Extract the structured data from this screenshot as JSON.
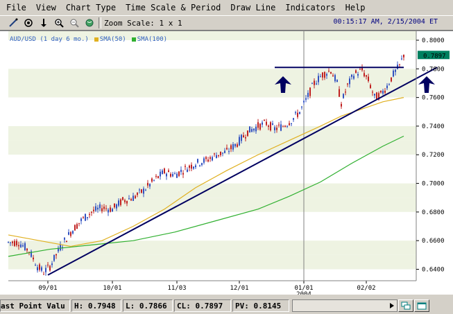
{
  "menu": {
    "items": [
      "File",
      "View",
      "Chart Type",
      "Time Scale & Period",
      "Draw Line",
      "Indicators",
      "Help"
    ]
  },
  "toolbar": {
    "icons": [
      "draw-line-icon",
      "crosshair-icon",
      "arrow-down-icon",
      "zoom-in-icon",
      "zoom-out-icon",
      "globe-icon"
    ],
    "zoom_label": "Zoom Scale: 1 x 1"
  },
  "datetime": "00:15:17 AM, 2/15/2004 ET",
  "legend": {
    "symbol": "AUD/USD (1 day  6 mo.)",
    "sma50": "SMA(50)",
    "sma100": "SMA(100)",
    "sma50_color": "#e0b020",
    "sma100_color": "#30b030"
  },
  "chart_data": {
    "type": "candlestick",
    "ylim": [
      0.632,
      0.8063
    ],
    "yticks": [
      "0.8000",
      "0.7800",
      "0.7600",
      "0.7400",
      "0.7200",
      "0.7000",
      "0.6800",
      "0.6600",
      "0.6400"
    ],
    "xticks": [
      "09/01",
      "10/01",
      "11/03",
      "12/01",
      "01/01",
      "02/02"
    ],
    "xtick_year": "2004",
    "last_price": "0.7897",
    "up_color": "#3050c0",
    "down_color": "#c02020",
    "sma50_color": "#e0b020",
    "sma100_color": "#30b030",
    "trendline_color": "#000060",
    "close_points": [
      [
        0,
        0.6588
      ],
      [
        5,
        0.6588
      ],
      [
        10,
        0.653
      ],
      [
        14,
        0.642
      ],
      [
        17,
        0.638
      ],
      [
        20,
        0.642
      ],
      [
        25,
        0.6555
      ],
      [
        30,
        0.666
      ],
      [
        35,
        0.674
      ],
      [
        40,
        0.68
      ],
      [
        45,
        0.683
      ],
      [
        50,
        0.682
      ],
      [
        55,
        0.688
      ],
      [
        60,
        0.69
      ],
      [
        65,
        0.695
      ],
      [
        70,
        0.702
      ],
      [
        75,
        0.708
      ],
      [
        80,
        0.706
      ],
      [
        85,
        0.71
      ],
      [
        90,
        0.714
      ],
      [
        95,
        0.716
      ],
      [
        100,
        0.72
      ],
      [
        105,
        0.722
      ],
      [
        110,
        0.728
      ],
      [
        115,
        0.736
      ],
      [
        120,
        0.74
      ],
      [
        124,
        0.742
      ],
      [
        128,
        0.738
      ],
      [
        132,
        0.74
      ],
      [
        136,
        0.744
      ],
      [
        140,
        0.75
      ],
      [
        143,
        0.758
      ],
      [
        147,
        0.77
      ],
      [
        151,
        0.776
      ],
      [
        155,
        0.779
      ],
      [
        158,
        0.77
      ],
      [
        160,
        0.756
      ],
      [
        163,
        0.768
      ],
      [
        166,
        0.776
      ],
      [
        170,
        0.779
      ],
      [
        173,
        0.772
      ],
      [
        176,
        0.76
      ],
      [
        179,
        0.762
      ],
      [
        182,
        0.768
      ],
      [
        185,
        0.776
      ],
      [
        188,
        0.782
      ],
      [
        190,
        0.7897
      ]
    ],
    "sma50_points": [
      [
        0,
        0.664
      ],
      [
        15,
        0.66
      ],
      [
        30,
        0.656
      ],
      [
        45,
        0.66
      ],
      [
        60,
        0.67
      ],
      [
        75,
        0.682
      ],
      [
        90,
        0.697
      ],
      [
        105,
        0.709
      ],
      [
        120,
        0.72
      ],
      [
        135,
        0.73
      ],
      [
        150,
        0.74
      ],
      [
        160,
        0.747
      ],
      [
        170,
        0.752
      ],
      [
        180,
        0.757
      ],
      [
        190,
        0.76
      ]
    ],
    "sma100_points": [
      [
        0,
        0.649
      ],
      [
        20,
        0.654
      ],
      [
        40,
        0.657
      ],
      [
        60,
        0.66
      ],
      [
        80,
        0.666
      ],
      [
        100,
        0.674
      ],
      [
        120,
        0.682
      ],
      [
        135,
        0.691
      ],
      [
        150,
        0.701
      ],
      [
        165,
        0.714
      ],
      [
        180,
        0.726
      ],
      [
        190,
        0.733
      ]
    ],
    "trendline": [
      [
        19,
        0.636
      ],
      [
        206,
        0.781
      ]
    ],
    "resistance": [
      [
        128,
        0.781
      ],
      [
        190,
        0.781
      ]
    ],
    "arrows": [
      {
        "x": 132,
        "y": 0.77
      },
      {
        "x": 201,
        "y": 0.77
      }
    ]
  },
  "status": {
    "last_point": "ast Point Valu",
    "high": "H: 0.7948",
    "low": "L: 0.7866",
    "close": "CL: 0.7897",
    "pv": "PV: 0.8145"
  }
}
